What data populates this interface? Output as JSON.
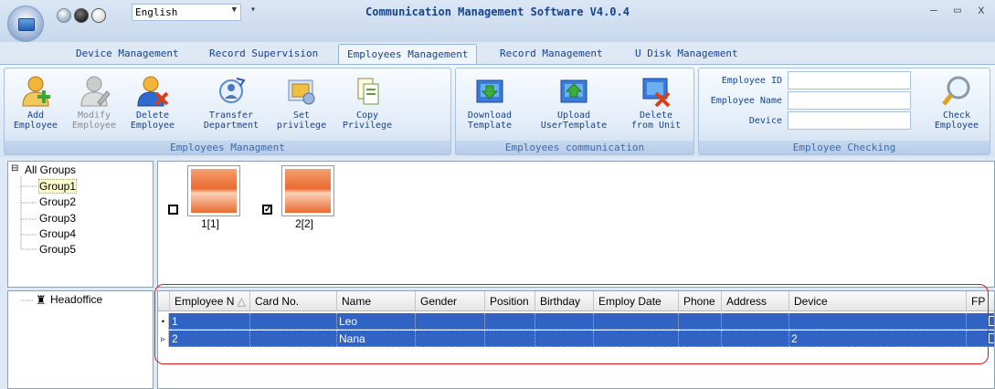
{
  "app": {
    "title": "Communication Management Software V4.0.4",
    "language": "English",
    "window_controls": {
      "minimize": "–",
      "maximize": "▭",
      "close": "x"
    }
  },
  "tabs": [
    {
      "label": "Device Management"
    },
    {
      "label": "Record Supervision"
    },
    {
      "label": "Employees Management",
      "active": true
    },
    {
      "label": "Record Management"
    },
    {
      "label": "U Disk Management"
    }
  ],
  "ribbon": {
    "groups": {
      "manage": "Employees Managment",
      "comm": "Employees communication",
      "check": "Employee Checking"
    },
    "buttons": {
      "add": "Add\nEmployee",
      "modify": "Modify\nEmployee",
      "delete": "Delete\nEmployee",
      "transfer": "Transfer\nDepartment",
      "set_priv": "Set\nprivilege",
      "copy_priv": "Copy\nPrivilege",
      "download": "Download\nTemplate",
      "upload": "Upload\nUserTemplate",
      "delete_unit": "Delete\nfrom Unit",
      "check": "Check\nEmployee"
    },
    "fields": {
      "employee_id": "Employee ID",
      "employee_name": "Employee Name",
      "device": "Device"
    }
  },
  "tree": {
    "root": "All Groups",
    "expander": "⊟",
    "groups": [
      "Group1",
      "Group2",
      "Group3",
      "Group4",
      "Group5"
    ],
    "selected": "Group1"
  },
  "photos": [
    {
      "label": "1[1]",
      "checked": false,
      "check_mark": ""
    },
    {
      "label": "2[2]",
      "checked": true,
      "check_mark": "✓"
    }
  ],
  "departments": {
    "root": "Headoffice"
  },
  "grid": {
    "columns": [
      "Employee N",
      "Card No.",
      "Name",
      "Gender",
      "Position",
      "Birthday",
      "Employ Date",
      "Phone",
      "Address",
      "Device",
      "FP"
    ],
    "sort_glyph": "△",
    "rows": [
      {
        "indicator": "•",
        "cells": [
          "1",
          "",
          "Leo",
          "",
          "",
          "",
          "",
          "",
          "",
          "",
          ""
        ]
      },
      {
        "indicator": "▹",
        "cells": [
          "2",
          "",
          "Nana",
          "",
          "",
          "",
          "",
          "",
          "",
          "2",
          ""
        ]
      }
    ]
  },
  "colors": {
    "accent": "#15428b",
    "selection": "#3163c5",
    "highlight": "#e01818"
  }
}
